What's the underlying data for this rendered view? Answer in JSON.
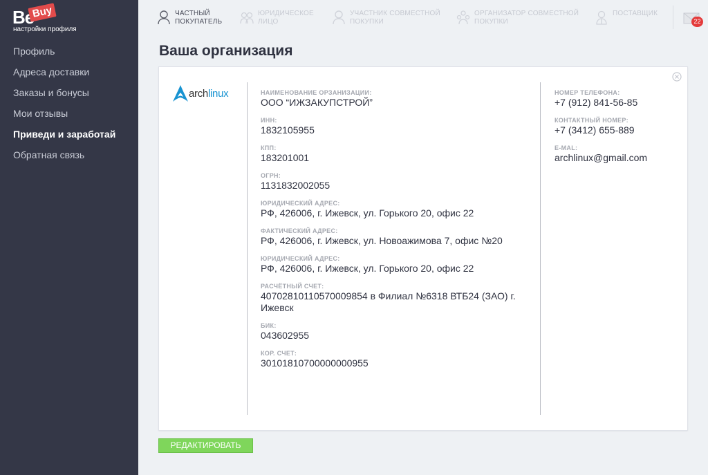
{
  "brand": {
    "be": "Be",
    "buy": "Buy",
    "subtitle": "настройки профиля"
  },
  "sidebar": {
    "items": [
      {
        "label": "Профиль"
      },
      {
        "label": "Адреса доставки"
      },
      {
        "label": "Заказы и бонусы"
      },
      {
        "label": "Мои отзывы"
      },
      {
        "label": "Приведи и заработай",
        "active": true
      },
      {
        "label": "Обратная связь"
      }
    ]
  },
  "roles": [
    {
      "label": "Частный\nпокупатель",
      "active": true,
      "icon": "person-icon"
    },
    {
      "label": "Юридическое\nлицо",
      "active": false,
      "icon": "people-icon"
    },
    {
      "label": "Участник совместной\nпокупки",
      "active": false,
      "icon": "person-icon"
    },
    {
      "label": "Организатор совместной\nпокупки",
      "active": false,
      "icon": "organizer-icon"
    },
    {
      "label": "Поставщик",
      "active": false,
      "icon": "supplier-icon"
    }
  ],
  "mail": {
    "count": "22",
    "icon": "mail-icon"
  },
  "page": {
    "title": "Ваша организация"
  },
  "org": {
    "logo_text_1": "arch",
    "logo_text_2": "linux",
    "logo_color": "#1793d1",
    "fields": [
      {
        "label": "Наименование орзанизации:",
        "value": "ООО “ИЖЗАКУПСТРОЙ”"
      },
      {
        "label": "ИНН:",
        "value": "1832105955"
      },
      {
        "label": "КПП:",
        "value": "183201001"
      },
      {
        "label": "ОГРН:",
        "value": "1131832002055"
      },
      {
        "label": "Юридический адрес:",
        "value": "РФ, 426006, г. Ижевск, ул. Горького 20, офис 22"
      },
      {
        "label": "Фактический адрес:",
        "value": "РФ, 426006, г. Ижевск, ул. Новоажимова 7, офис №20"
      },
      {
        "label": "Юридический адрес:",
        "value": "РФ, 426006, г. Ижевск, ул. Горького 20, офис 22"
      },
      {
        "label": "Расчётный счет:",
        "value": "40702810110570009854 в Филиал №6318 ВТБ24 (ЗАО) г. Ижевск"
      },
      {
        "label": "БИК:",
        "value": "043602955"
      },
      {
        "label": "Кор. счет:",
        "value": "30101810700000000955"
      }
    ],
    "contacts": [
      {
        "label": "Номер телефона:",
        "value": "+7 (912) 841-56-85"
      },
      {
        "label": "Контактный номер:",
        "value": "+7 (3412) 655-889"
      },
      {
        "label": "E-mal:",
        "value": "archlinux@gmail.com"
      }
    ]
  },
  "actions": {
    "edit_label": "Редактировать"
  },
  "colors": {
    "sidebar_bg": "#343747",
    "accent_green": "#7fd65b",
    "badge_red": "#e43b3b",
    "brand_red": "#e24b4b"
  }
}
